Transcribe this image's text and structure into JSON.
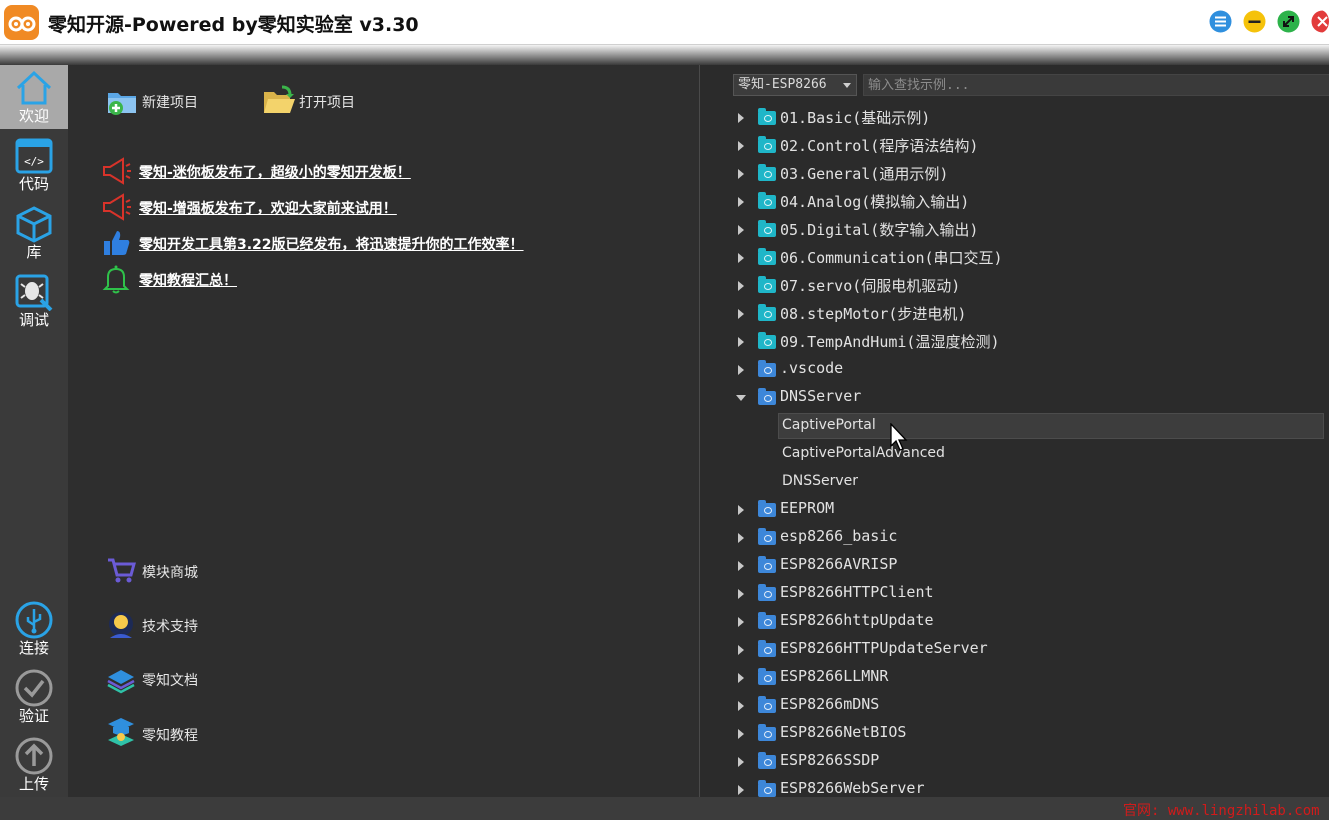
{
  "window": {
    "title": "零知开源-Powered by零知实验室 v3.30",
    "colors": {
      "menu": "#2f8fde",
      "minimize": "#f5c20a",
      "maximize": "#2db24a",
      "close": "#e23b3b"
    }
  },
  "nav": {
    "top": [
      {
        "label": "欢迎",
        "icon": "home-icon",
        "active": true
      },
      {
        "label": "代码",
        "icon": "code-icon",
        "active": false
      },
      {
        "label": "库",
        "icon": "cube-icon",
        "active": false
      },
      {
        "label": "调试",
        "icon": "debug-icon",
        "active": false
      }
    ],
    "bottom": [
      {
        "label": "连接",
        "icon": "usb-icon"
      },
      {
        "label": "验证",
        "icon": "check-icon"
      },
      {
        "label": "上传",
        "icon": "upload-icon"
      }
    ]
  },
  "welcome": {
    "new_project": "新建项目",
    "open_project": "打开项目",
    "news": [
      {
        "text": "零知-迷你板发布了，超级小的零知开发板！",
        "icon": "megaphone-icon"
      },
      {
        "text": "零知-增强板发布了，欢迎大家前来试用！",
        "icon": "megaphone-icon"
      },
      {
        "text": "零知开发工具第3.22版已经发布，将迅速提升你的工作效率！",
        "icon": "thumbs-up-icon"
      },
      {
        "text": "零知教程汇总！",
        "icon": "bell-icon"
      }
    ],
    "links": [
      {
        "text": "模块商城",
        "icon": "cart-icon"
      },
      {
        "text": "技术支持",
        "icon": "support-icon"
      },
      {
        "text": "零知文档",
        "icon": "docs-icon"
      },
      {
        "text": "零知教程",
        "icon": "tutorial-icon"
      }
    ]
  },
  "examples": {
    "board": "零知-ESP8266",
    "search_placeholder": "输入查找示例...",
    "tree": [
      {
        "label": "01.Basic(基础示例)",
        "kind": "teal",
        "expanded": false
      },
      {
        "label": "02.Control(程序语法结构)",
        "kind": "teal",
        "expanded": false
      },
      {
        "label": "03.General(通用示例)",
        "kind": "teal",
        "expanded": false
      },
      {
        "label": "04.Analog(模拟输入输出)",
        "kind": "teal",
        "expanded": false
      },
      {
        "label": "05.Digital(数字输入输出)",
        "kind": "teal",
        "expanded": false
      },
      {
        "label": "06.Communication(串口交互)",
        "kind": "teal",
        "expanded": false
      },
      {
        "label": "07.servo(伺服电机驱动)",
        "kind": "teal",
        "expanded": false
      },
      {
        "label": "08.stepMotor(步进电机)",
        "kind": "teal",
        "expanded": false
      },
      {
        "label": "09.TempAndHumi(温湿度检测)",
        "kind": "teal",
        "expanded": false
      },
      {
        "label": ".vscode",
        "kind": "blue",
        "expanded": false
      },
      {
        "label": "DNSServer",
        "kind": "blue",
        "expanded": true,
        "children": [
          {
            "label": "CaptivePortal",
            "selected": true
          },
          {
            "label": "CaptivePortalAdvanced",
            "selected": false
          },
          {
            "label": "DNSServer",
            "selected": false
          }
        ]
      },
      {
        "label": "EEPROM",
        "kind": "blue",
        "expanded": false
      },
      {
        "label": "esp8266_basic",
        "kind": "blue",
        "expanded": false
      },
      {
        "label": "ESP8266AVRISP",
        "kind": "blue",
        "expanded": false
      },
      {
        "label": "ESP8266HTTPClient",
        "kind": "blue",
        "expanded": false
      },
      {
        "label": "ESP8266httpUpdate",
        "kind": "blue",
        "expanded": false
      },
      {
        "label": "ESP8266HTTPUpdateServer",
        "kind": "blue",
        "expanded": false
      },
      {
        "label": "ESP8266LLMNR",
        "kind": "blue",
        "expanded": false
      },
      {
        "label": "ESP8266mDNS",
        "kind": "blue",
        "expanded": false
      },
      {
        "label": "ESP8266NetBIOS",
        "kind": "blue",
        "expanded": false
      },
      {
        "label": "ESP8266SSDP",
        "kind": "blue",
        "expanded": false
      },
      {
        "label": "ESP8266WebServer",
        "kind": "blue",
        "expanded": false
      }
    ]
  },
  "status": {
    "site": "官网: www.lingzhilab.com"
  }
}
